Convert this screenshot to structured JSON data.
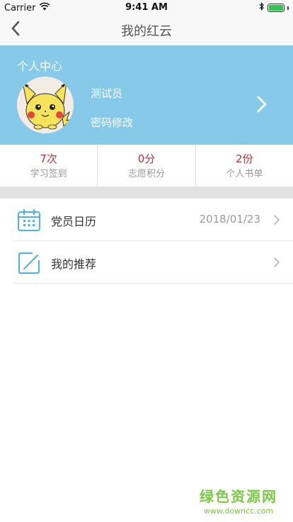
{
  "status_bar": {
    "carrier": "Carrier",
    "time": "9:41 AM",
    "battery_level": 1.0
  },
  "nav": {
    "title": "我的红云",
    "back_icon": "chevron-left-icon"
  },
  "profile": {
    "heading": "个人中心",
    "name": "测试员",
    "password_link": "密码修改",
    "avatar_icon": "pikachu-avatar",
    "background_color": "#86c9e8"
  },
  "stats": [
    {
      "value": "7次",
      "label": "学习签到"
    },
    {
      "value": "0分",
      "label": "志愿积分"
    },
    {
      "value": "2份",
      "label": "个人书单"
    }
  ],
  "menu": [
    {
      "label": "党员日历",
      "value": "2018/01/23",
      "icon": "calendar-icon"
    },
    {
      "label": "我的推荐",
      "value": "",
      "icon": "edit-icon"
    }
  ],
  "watermark": {
    "title": "绿色资源网",
    "url": "www.downcc.com"
  },
  "colors": {
    "accent": "#86c9e8",
    "stat_value": "#b3323c",
    "watermark": "#7ac943"
  }
}
